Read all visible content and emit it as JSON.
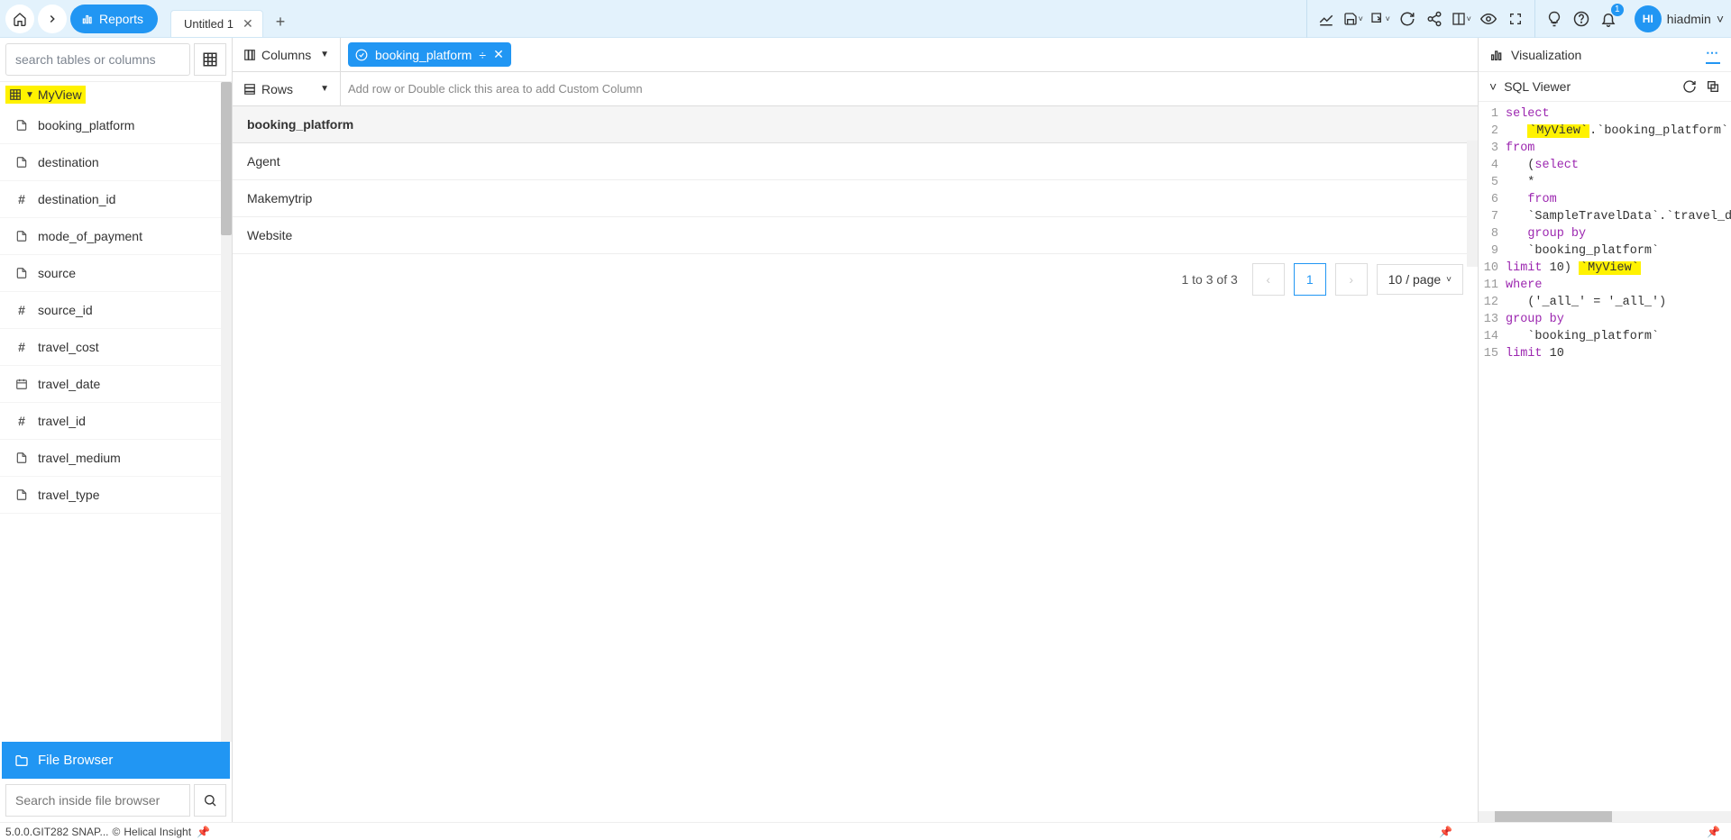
{
  "breadcrumb": {
    "reports_label": "Reports"
  },
  "tabs": {
    "active_label": "Untitled 1"
  },
  "notifications": {
    "count": "1"
  },
  "user": {
    "avatar_initials": "HI",
    "name": "hiadmin"
  },
  "toolbar_icons": {
    "chart": "chart-icon",
    "save": "save-icon",
    "export": "export-icon",
    "refresh": "refresh-icon",
    "share": "share-icon",
    "layout": "layout-icon",
    "eye": "eye-icon",
    "fullscreen": "fullscreen-icon",
    "bulb": "bulb-icon",
    "help": "help-icon",
    "bell": "bell-icon"
  },
  "sidebar": {
    "search_placeholder": "search tables or columns",
    "table_name": "MyView",
    "fields": [
      {
        "icon": "text",
        "label": "booking_platform"
      },
      {
        "icon": "text",
        "label": "destination"
      },
      {
        "icon": "number",
        "label": "destination_id"
      },
      {
        "icon": "text",
        "label": "mode_of_payment"
      },
      {
        "icon": "text",
        "label": "source"
      },
      {
        "icon": "number",
        "label": "source_id"
      },
      {
        "icon": "number",
        "label": "travel_cost"
      },
      {
        "icon": "date",
        "label": "travel_date"
      },
      {
        "icon": "number",
        "label": "travel_id"
      },
      {
        "icon": "text",
        "label": "travel_medium"
      },
      {
        "icon": "text",
        "label": "travel_type"
      }
    ],
    "file_browser_label": "File Browser",
    "file_browser_search_placeholder": "Search inside file browser"
  },
  "shelves": {
    "columns_label": "Columns",
    "columns_pill": "booking_platform",
    "rows_label": "Rows",
    "rows_placeholder": "Add row or Double click this area to add Custom Column"
  },
  "data": {
    "header": "booking_platform",
    "rows": [
      "Agent",
      "Makemytrip",
      "Website"
    ]
  },
  "pager": {
    "info": "1 to 3 of 3",
    "current_page": "1",
    "page_size_label": "10 / page"
  },
  "right": {
    "viz_label": "Visualization",
    "sql_label": "SQL Viewer",
    "sql_lines": [
      {
        "n": "1",
        "tokens": [
          [
            "kw",
            "select"
          ]
        ]
      },
      {
        "n": "2",
        "tokens": [
          [
            "pad",
            "   "
          ],
          [
            "hl",
            "`MyView`"
          ],
          [
            "str",
            ".`booking_platform` as"
          ]
        ]
      },
      {
        "n": "3",
        "tokens": [
          [
            "kw",
            "from"
          ]
        ]
      },
      {
        "n": "4",
        "tokens": [
          [
            "pad",
            "   ("
          ],
          [
            "kw",
            "select"
          ]
        ]
      },
      {
        "n": "5",
        "tokens": [
          [
            "pad",
            "   *"
          ]
        ]
      },
      {
        "n": "6",
        "tokens": [
          [
            "pad",
            "   "
          ],
          [
            "kw",
            "from"
          ]
        ]
      },
      {
        "n": "7",
        "tokens": [
          [
            "pad",
            "   `SampleTravelData`.`travel_deta"
          ]
        ]
      },
      {
        "n": "8",
        "tokens": [
          [
            "pad",
            "   "
          ],
          [
            "kw",
            "group by"
          ]
        ]
      },
      {
        "n": "9",
        "tokens": [
          [
            "pad",
            "   `booking_platform`"
          ]
        ]
      },
      {
        "n": "10",
        "tokens": [
          [
            "kw",
            "limit"
          ],
          [
            "str",
            " 10) "
          ],
          [
            "hl",
            "`MyView`"
          ]
        ]
      },
      {
        "n": "11",
        "tokens": [
          [
            "kw",
            "where"
          ]
        ]
      },
      {
        "n": "12",
        "tokens": [
          [
            "pad",
            "   ('_all_' = '_all_')"
          ]
        ]
      },
      {
        "n": "13",
        "tokens": [
          [
            "kw",
            "group by"
          ]
        ]
      },
      {
        "n": "14",
        "tokens": [
          [
            "pad",
            "   `booking_platform`"
          ]
        ]
      },
      {
        "n": "15",
        "tokens": [
          [
            "kw",
            "limit"
          ],
          [
            "str",
            " 10"
          ]
        ]
      }
    ]
  },
  "footer": {
    "version": "5.0.0.GIT282 SNAP...",
    "brand": "Helical Insight"
  }
}
